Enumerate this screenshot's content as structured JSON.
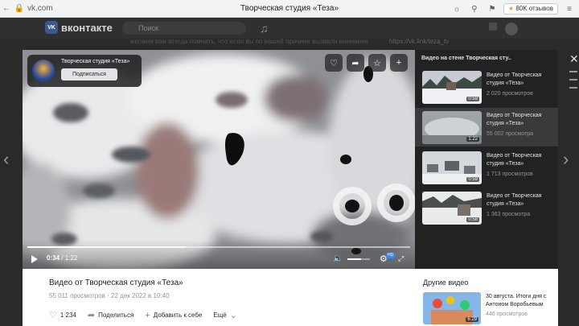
{
  "browser": {
    "url": "vk.com",
    "tab_title": "Творческая студия «Теза»",
    "reviews": "80K отзывов"
  },
  "vk": {
    "logo": "вконтакте",
    "search_placeholder": "Поиск",
    "bg_text": "желаем вам всегда помнить, что если вы по нашей причине вызвали внимание",
    "bg_link": "https://vk.link/teza_tv"
  },
  "channel": {
    "name": "Творческая студия «Теза»",
    "subscribe": "Подписаться"
  },
  "player": {
    "current_time": "0:34",
    "duration": "1:22",
    "progress": 0.414,
    "volume": 0.6,
    "hd_label": "HD"
  },
  "sidebar": {
    "title": "Видео на стене Творческая сту..",
    "items": [
      {
        "title": "Видео от Творческая студия «Теза»",
        "views": "2 020 просмотров",
        "duration": "0:59"
      },
      {
        "title": "Видео от Творческая студия «Теза»",
        "views": "55 002 просмотра",
        "duration": "1:22"
      },
      {
        "title": "Видео от Творческая студия «Теза»",
        "views": "1 713 просмотров",
        "duration": "0:59"
      },
      {
        "title": "Видео от Творческая студия «Теза»",
        "views": "1 363 просмотра",
        "duration": "0:58"
      }
    ]
  },
  "video": {
    "title": "Видео от Творческая студия «Теза»",
    "views": "55 011 просмотров",
    "date": "22 дек 2022 в 10:40",
    "likes": "1 234",
    "share": "Поделиться",
    "add": "Добавить к себе",
    "more": "Ещё"
  },
  "other_videos": {
    "title": "Другие видео",
    "item_title": "30 августа. Итоги дня с Антоном Воробьевым",
    "item_views": "446 просмотров",
    "item_duration": "6:29"
  }
}
